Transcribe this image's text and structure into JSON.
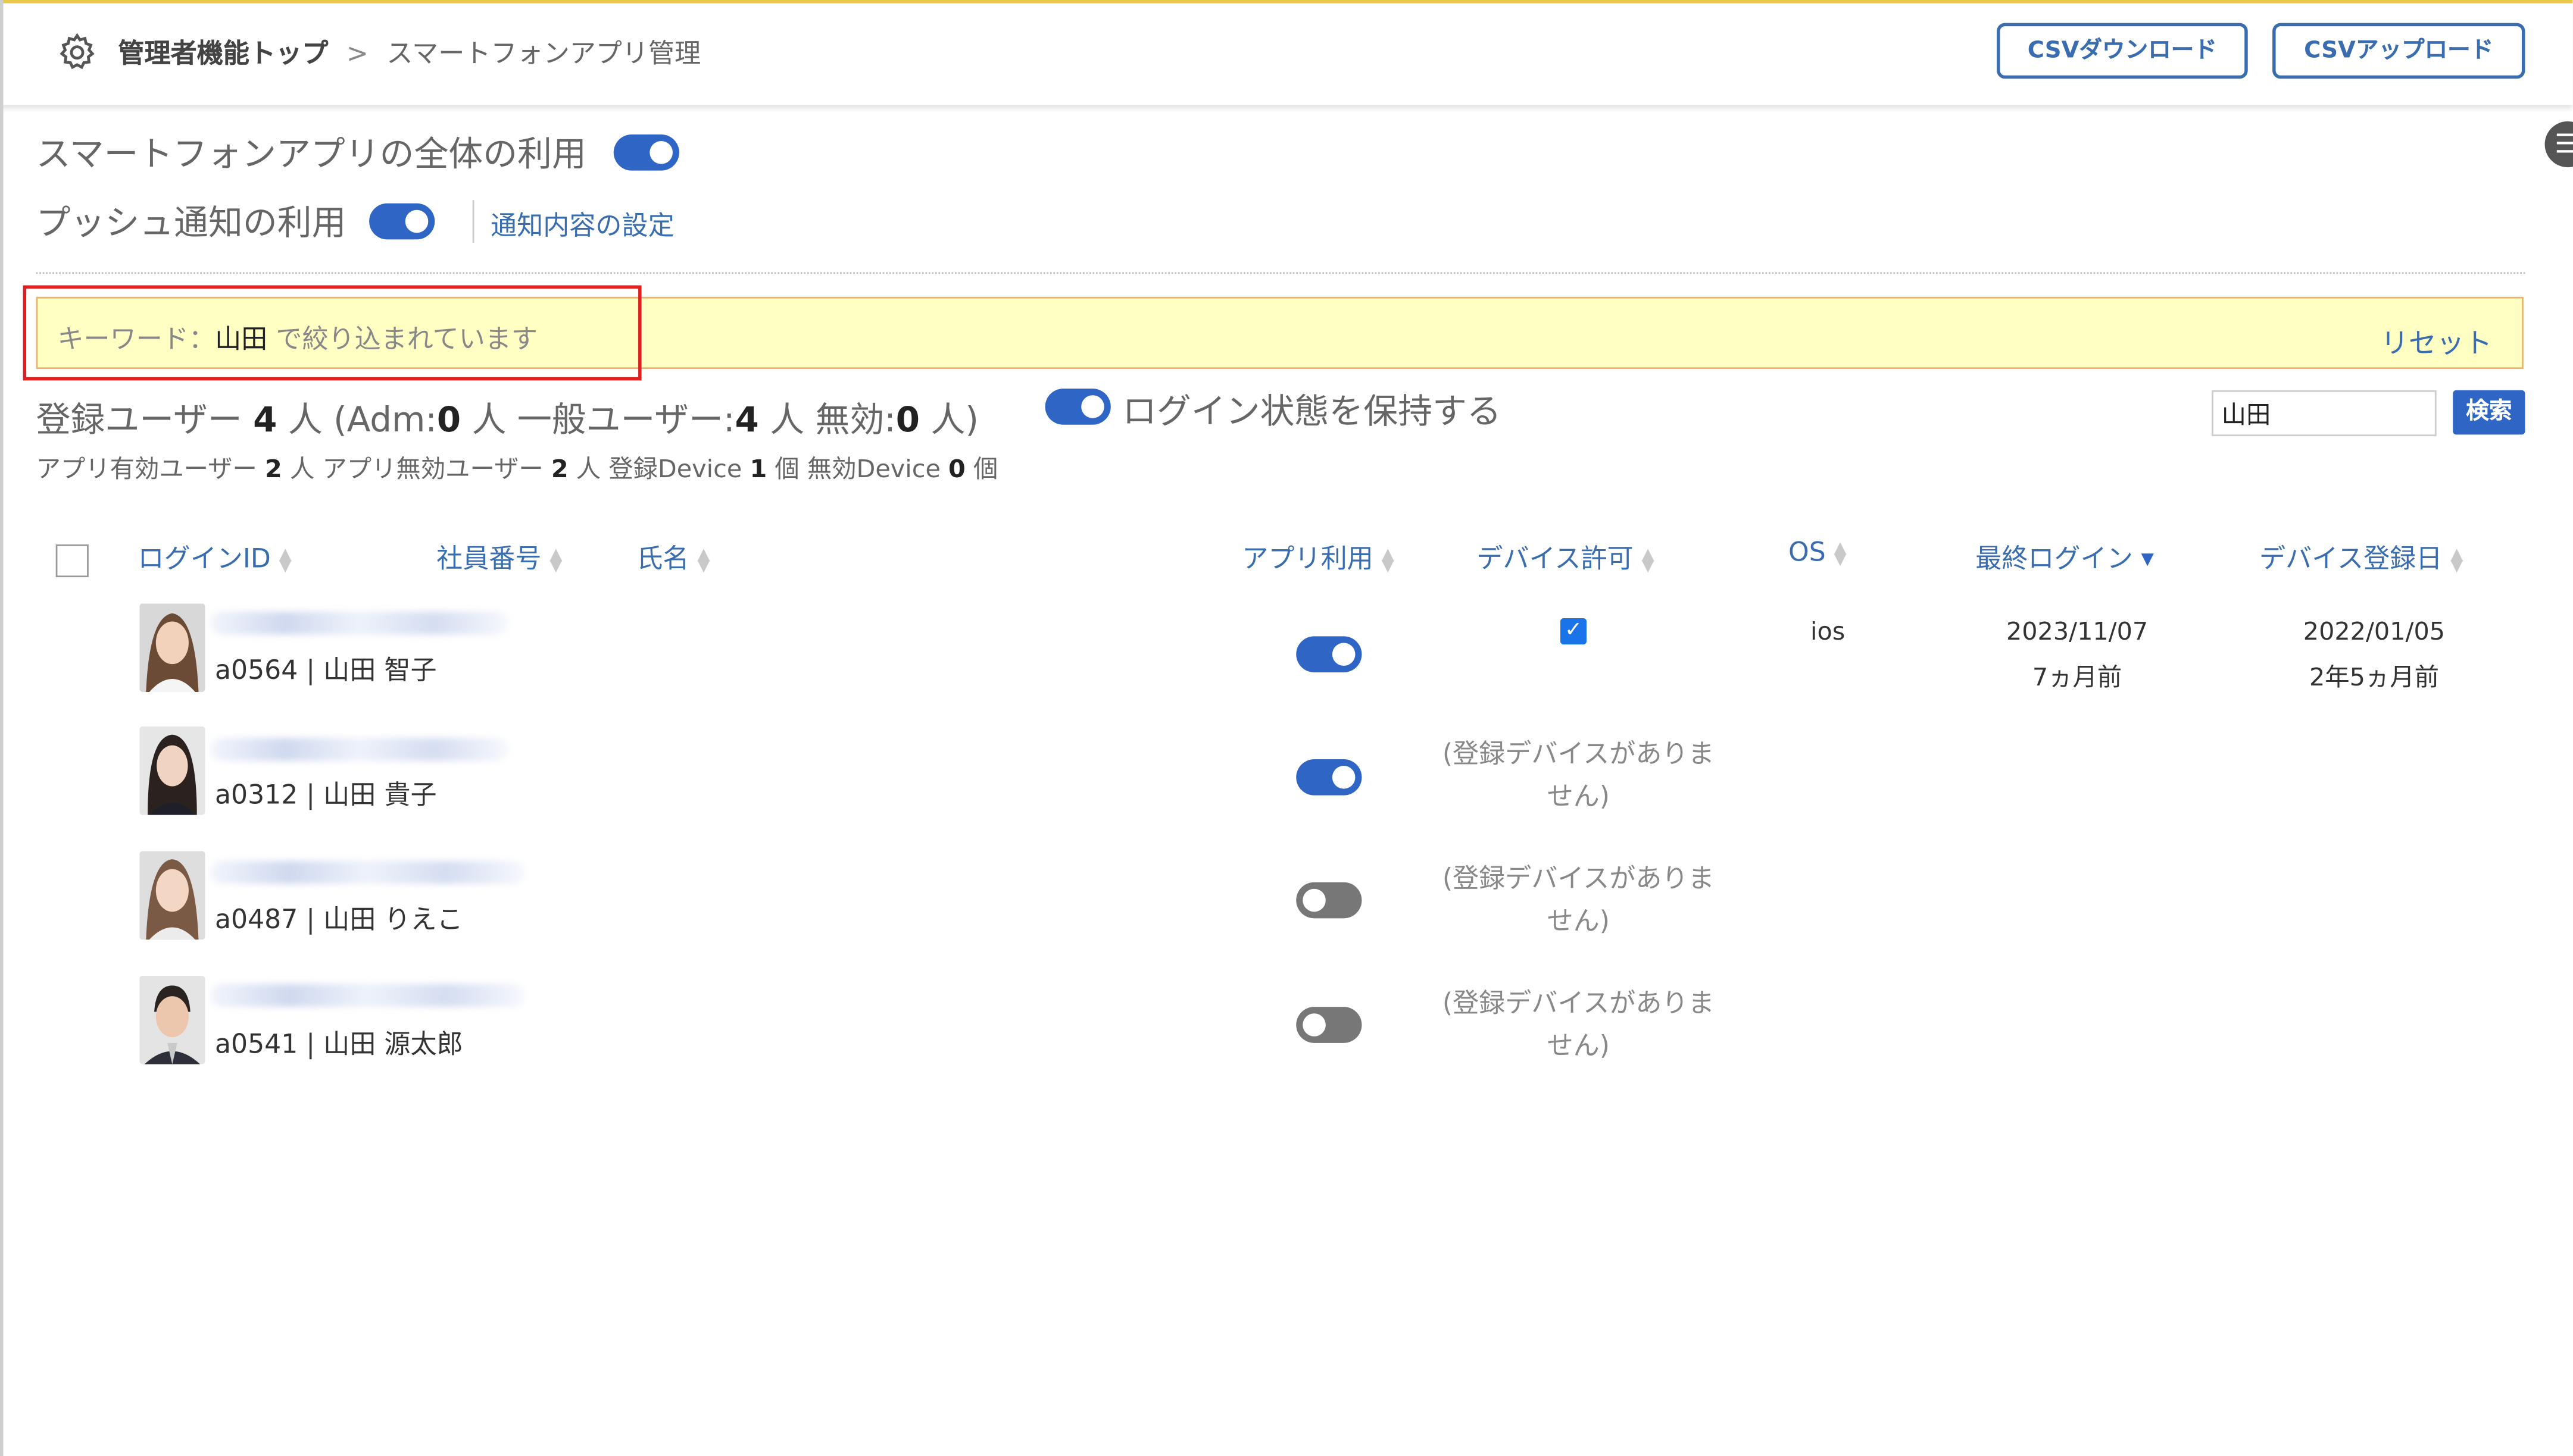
{
  "header": {
    "breadcrumb_root": "管理者機能トップ",
    "breadcrumb_sep": ">",
    "breadcrumb_current": "スマートフォンアプリ管理",
    "csv_download": "CSVダウンロード",
    "csv_upload": "CSVアップロード"
  },
  "settings": {
    "app_overall_label": "スマートフォンアプリの全体の利用",
    "push_label": "プッシュ通知の利用",
    "notify_settings_link": "通知内容の設定"
  },
  "filter": {
    "prefix": "キーワード：",
    "keyword": "山田",
    "suffix": " で絞り込まれています",
    "reset": "リセット"
  },
  "stats": {
    "line1_a": "登録ユーザー ",
    "registered": "4",
    "line1_b": " 人 (Adm:",
    "adm": "0",
    "line1_c": " 人 一般ユーザー:",
    "general": "4",
    "line1_d": " 人 無効:",
    "invalid": "0",
    "line1_e": " 人)",
    "keep_login": "ログイン状態を保持する",
    "line2_a": "アプリ有効ユーザー ",
    "app_enabled": "2",
    "line2_b": " 人 アプリ無効ユーザー ",
    "app_disabled": "2",
    "line2_c": " 人 登録Device ",
    "devices": "1",
    "line2_d": " 個 無効Device ",
    "invalid_devices": "0",
    "line2_e": " 個"
  },
  "search": {
    "value": "山田",
    "button": "検索"
  },
  "columns": {
    "login_id": "ログインID",
    "employee_no": "社員番号",
    "name": "氏名",
    "app_use": "アプリ利用",
    "device_permit": "デバイス許可",
    "os": "OS",
    "last_login": "最終ログイン",
    "device_registered": "デバイス登録日"
  },
  "rows": [
    {
      "name_line": "a0564 | 山田 智子",
      "app_use": "on",
      "device_permit": "checked",
      "os": "ios",
      "last_login_date": "2023/11/07",
      "last_login_rel": "7ヵ月前",
      "device_date": "2022/01/05",
      "device_rel": "2年5ヵ月前"
    },
    {
      "name_line": "a0312 | 山田 貴子",
      "app_use": "on",
      "no_device_1": "(登録デバイスがありま",
      "no_device_2": "せん)"
    },
    {
      "name_line": "a0487 | 山田 りえこ",
      "app_use": "off",
      "no_device_1": "(登録デバイスがありま",
      "no_device_2": "せん)"
    },
    {
      "name_line": "a0541 | 山田 源太郎",
      "app_use": "off",
      "no_device_1": "(登録デバイスがありま",
      "no_device_2": "せん)"
    }
  ],
  "icons": {
    "settings": "gear-icon",
    "side": "menu-icon"
  },
  "colors": {
    "accent": "#2f66c6",
    "filter_bg": "#ffffc4",
    "highlight": "#e02020",
    "topbar_line": "#e8c84a"
  }
}
